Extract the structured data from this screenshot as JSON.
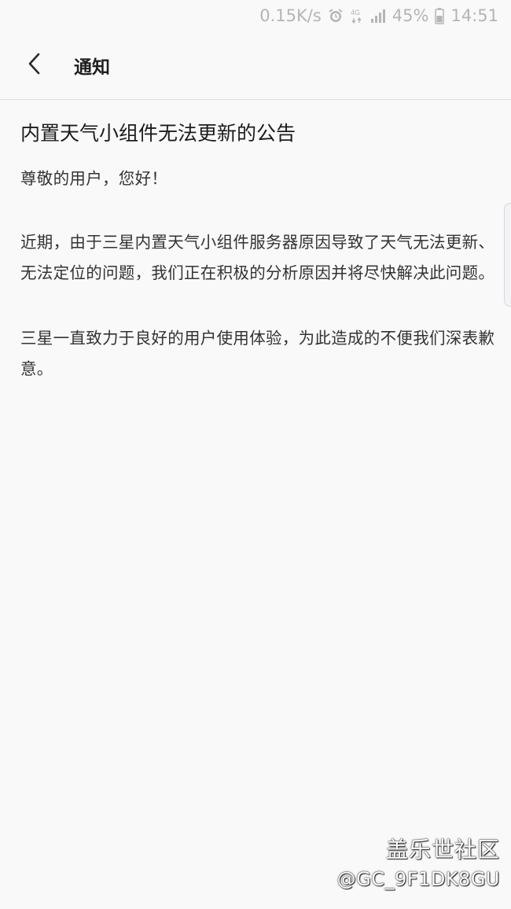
{
  "status_bar": {
    "net_speed": "0.15K/s",
    "network_type": "4G",
    "battery": "45%",
    "time": "14:51",
    "icons": [
      "alarm-icon",
      "network-4g-icon",
      "signal-icon",
      "battery-icon"
    ]
  },
  "app_bar": {
    "title": "通知",
    "back_icon": "chevron-left-icon"
  },
  "notice": {
    "title": "内置天气小组件无法更新的公告",
    "greeting": "尊敬的用户，您好！",
    "paragraphs": [
      "近期，由于三星内置天气小组件服务器原因导致了天气无法更新、无法定位的问题，我们正在积极的分析原因并将尽快解决此问题。",
      "三星一直致力于良好的用户使用体验，为此造成的不便我们深表歉意。"
    ]
  },
  "watermark": {
    "brand": "盖乐世社区",
    "user": "@GC_9F1DK8GU"
  },
  "colors": {
    "background": "#f9f9fa",
    "status_text": "#b5b5b8",
    "title_text": "#1f1f1f",
    "body_text": "#333333",
    "divider": "#dcdcdf"
  }
}
